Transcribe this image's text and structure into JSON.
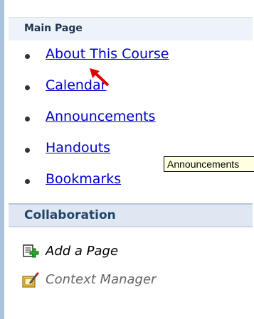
{
  "main": {
    "header": "Main Page",
    "links": [
      {
        "label": "About This Course"
      },
      {
        "label": "Calendar"
      },
      {
        "label": "Announcements"
      },
      {
        "label": "Handouts"
      },
      {
        "label": "Bookmarks"
      }
    ]
  },
  "collaboration": {
    "header": "Collaboration",
    "actions": [
      {
        "label": "Add a Page",
        "icon": "add-page-icon"
      },
      {
        "label": "Context Manager",
        "icon": "context-manager-icon"
      }
    ]
  },
  "tooltip": {
    "text": "Announcements"
  },
  "colors": {
    "link": "#0000cc",
    "sidebar_border": "#a9c2de",
    "collab_header_bg": "#dfe8f2",
    "tooltip_bg": "#ffffe1",
    "cursor_arrow": "#e00000"
  }
}
